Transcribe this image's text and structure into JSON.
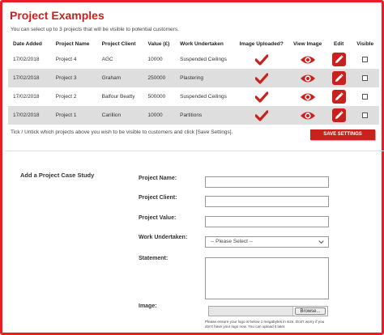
{
  "page": {
    "title": "Project Examples",
    "intro": "You can select up to 3 projects that will be visible to potential customers.",
    "accent_color": "#c9211e",
    "border_color": "#ec1c24"
  },
  "table": {
    "headers": [
      "Date Added",
      "Project Name",
      "Project Client",
      "Value (£)",
      "Work Undertaken",
      "Image Uploaded?",
      "View Image",
      "Edit",
      "Visible"
    ],
    "rows": [
      {
        "date": "17/02/2018",
        "name": "Project 4",
        "client": "AGC",
        "value": "10000",
        "work": "Suspended Ceilings",
        "uploaded_icon": "checkmark-icon",
        "view_icon": "eye-icon",
        "edit_icon": "pencil-icon",
        "visible": false
      },
      {
        "date": "17/02/2018",
        "name": "Project 3",
        "client": "Graham",
        "value": "250000",
        "work": "Plastering",
        "uploaded_icon": "checkmark-icon",
        "view_icon": "eye-icon",
        "edit_icon": "pencil-icon",
        "visible": false
      },
      {
        "date": "17/02/2018",
        "name": "Project 2",
        "client": "Balfour Beatty",
        "value": "500000",
        "work": "Suspended Ceilings",
        "uploaded_icon": "checkmark-icon",
        "view_icon": "eye-icon",
        "edit_icon": "pencil-icon",
        "visible": false
      },
      {
        "date": "17/02/2018",
        "name": "Project 1",
        "client": "Carillion",
        "value": "10000",
        "work": "Partitions",
        "uploaded_icon": "checkmark-icon",
        "view_icon": "eye-icon",
        "edit_icon": "pencil-icon",
        "visible": false
      }
    ]
  },
  "instructions": "Tick / Untick which projects above you wish to be visible to customers and click [Save Settings].",
  "save_button": "SAVE SETTINGS",
  "form": {
    "section_title": "Add a Project Case Study",
    "labels": {
      "name": "Project Name:",
      "client": "Project Client:",
      "value": "Project Value:",
      "work": "Work Undertaken:",
      "statement": "Statement:",
      "image": "Image:"
    },
    "work_select_value": "-- Please Select --",
    "browse_label": "Browse...",
    "image_note": "Please ensure your logo is below 1 megabytes in size. Don't worry if you don't have your logo now. You can upload it later."
  }
}
